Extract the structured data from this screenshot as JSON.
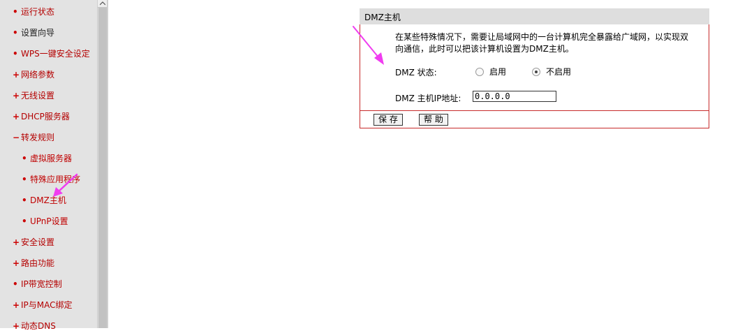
{
  "sidebar": {
    "items": [
      {
        "bullet": "•",
        "label": "运行状态"
      },
      {
        "bullet": "•",
        "label": "设置向导"
      },
      {
        "bullet": "•",
        "label": "WPS一键安全设定"
      },
      {
        "bullet": "+",
        "label": "网络参数"
      },
      {
        "bullet": "+",
        "label": "无线设置"
      },
      {
        "bullet": "+",
        "label": "DHCP服务器"
      },
      {
        "bullet": "−",
        "label": "转发规则"
      },
      {
        "bullet": "•",
        "label": "虚拟服务器"
      },
      {
        "bullet": "•",
        "label": "特殊应用程序"
      },
      {
        "bullet": "•",
        "label": "DMZ主机"
      },
      {
        "bullet": "•",
        "label": "UPnP设置"
      },
      {
        "bullet": "+",
        "label": "安全设置"
      },
      {
        "bullet": "+",
        "label": "路由功能"
      },
      {
        "bullet": "•",
        "label": "IP带宽控制"
      },
      {
        "bullet": "+",
        "label": "IP与MAC绑定"
      },
      {
        "bullet": "+",
        "label": "动态DNS"
      }
    ]
  },
  "panel": {
    "title": "DMZ主机",
    "description": "在某些特殊情况下，需要让局域网中的一台计算机完全暴露给广域网，以实现双向通信，此时可以把该计算机设置为DMZ主机。",
    "status_label": "DMZ 状态:",
    "radio_enable": "启用",
    "radio_disable": "不启用",
    "selected": "不启用",
    "ip_label": "DMZ 主机IP地址:",
    "ip_value": "0.0.0.0",
    "save_button": "保 存",
    "help_button": "帮 助"
  },
  "colors": {
    "menu_text": "#b40000",
    "panel_border": "#c72a2a",
    "annotation_arrow": "#f03cf0"
  }
}
